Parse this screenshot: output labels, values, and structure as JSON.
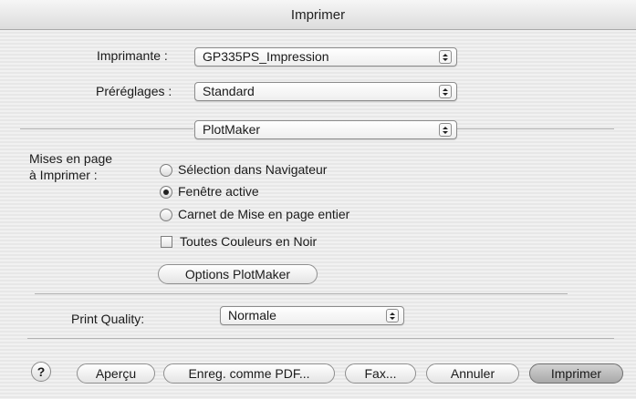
{
  "window": {
    "title": "Imprimer"
  },
  "printer": {
    "label": "Imprimante :",
    "value": "GP335PS_Impression"
  },
  "presets": {
    "label": "Préréglages :",
    "value": "Standard"
  },
  "panel": {
    "value": "PlotMaker"
  },
  "layouts": {
    "label_line1": "Mises en page",
    "label_line2": "à Imprimer :",
    "options": [
      {
        "label": "Sélection dans Navigateur",
        "selected": false
      },
      {
        "label": "Fenêtre active",
        "selected": true
      },
      {
        "label": "Carnet de Mise en page entier",
        "selected": false
      }
    ],
    "checkbox_label": "Toutes Couleurs en Noir",
    "checkbox_checked": false,
    "options_button": "Options PlotMaker"
  },
  "quality": {
    "label": "Print Quality:",
    "value": "Normale"
  },
  "buttons": {
    "help": "?",
    "preview": "Aperçu",
    "save_pdf": "Enreg. comme PDF...",
    "fax": "Fax...",
    "cancel": "Annuler",
    "print": "Imprimer"
  }
}
